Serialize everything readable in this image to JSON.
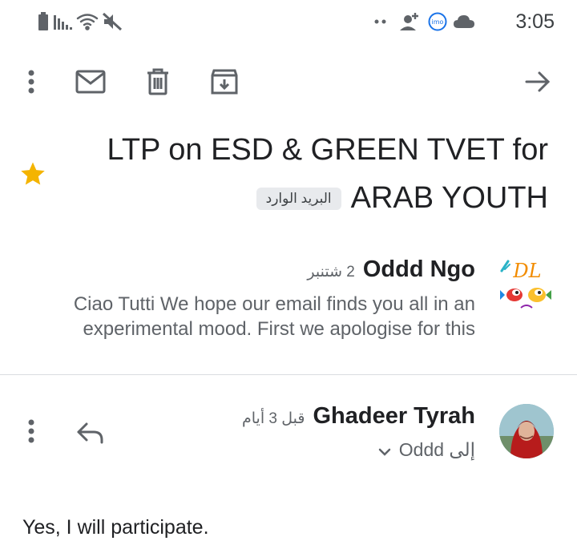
{
  "status_bar": {
    "time": "3:05",
    "icons": [
      "battery-icon",
      "signal-icon",
      "wifi-icon",
      "mute-icon",
      "dots-icon",
      "add-person-icon",
      "imo-icon",
      "cloud-icon"
    ],
    "imo_text": "imo"
  },
  "toolbar": {
    "icons": [
      "more-vert-icon",
      "mark-unread-icon",
      "delete-icon",
      "archive-icon",
      "forward-arrow-icon"
    ]
  },
  "subject": {
    "line1": "LTP on ESD & GREEN TVET for",
    "line2": "ARAB YOUTH",
    "label": "البريد الوارد",
    "starred": true,
    "star_color": "#f4b400"
  },
  "messages": [
    {
      "sender": "Oddd Ngo",
      "date": "2 شتنبر",
      "snippet_line1": "Ciao Tutti We hope our email finds you all in an",
      "snippet_line2": "experimental mood. First we apologise for this",
      "avatar_text": "DL"
    },
    {
      "sender": "Ghadeer Tyrah",
      "date": "قبل 3 أيام",
      "to_text": "إلى Oddd",
      "body": "Yes, I will participate."
    }
  ]
}
